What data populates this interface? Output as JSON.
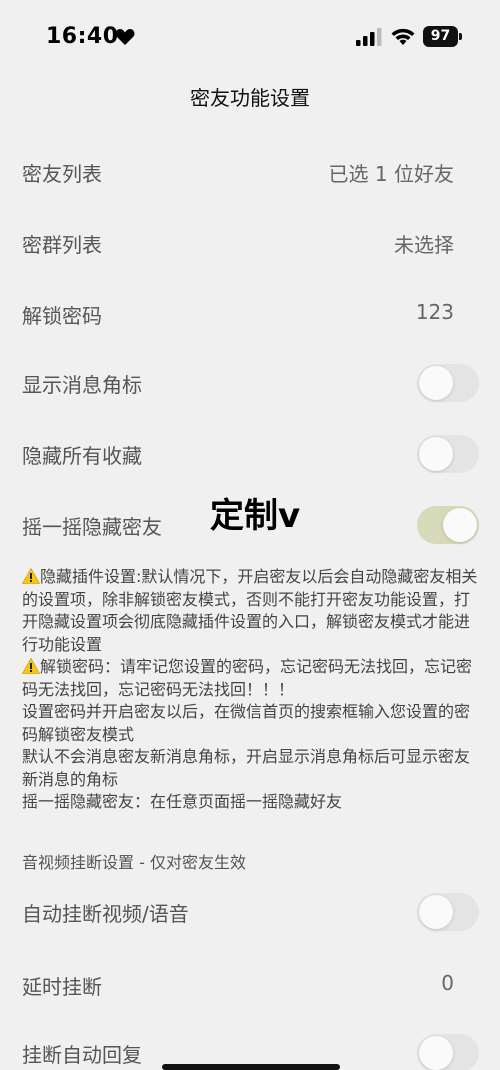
{
  "status_bar": {
    "time": "16:40",
    "battery": "97",
    "icons": [
      "heart-icon",
      "signal-icon",
      "wifi-icon",
      "battery-icon"
    ]
  },
  "header": {
    "title": "密友功能设置"
  },
  "settings": {
    "friend_list": {
      "label": "密友列表",
      "value": "已选 1 位好友"
    },
    "group_list": {
      "label": "密群列表",
      "value": "未选择"
    },
    "unlock_password": {
      "label": "解锁密码",
      "value": "123"
    },
    "show_badge": {
      "label": "显示消息角标",
      "on": false
    },
    "hide_favorites": {
      "label": "隐藏所有收藏",
      "on": false
    },
    "shake_hide": {
      "label": "摇一摇隐藏密友",
      "on": true
    }
  },
  "watermark": "定制v",
  "notes": {
    "line1": "隐藏插件设置:默认情况下，开启密友以后会自动隐藏密友相关的设置项，除非解锁密友模式，否则不能打开密友功能设置，打开隐藏设置项会彻底隐藏插件设置的入口，解锁密友模式才能进行功能设置",
    "line2": "解锁密码：请牢记您设置的密码，忘记密码无法找回，忘记密码无法找回，忘记密码无法找回！！！",
    "line3": "设置密码并开启密友以后，在微信首页的搜索框输入您设置的密码解锁密友模式",
    "line4": "默认不会消息密友新消息角标，开启显示消息角标后可显示密友新消息的角标",
    "line5": "摇一摇隐藏密友：在任意页面摇一摇隐藏好友"
  },
  "av_section": {
    "header": "音视频挂断设置 - 仅对密友生效",
    "auto_hangup": {
      "label": "自动挂断视频/语音",
      "on": false
    },
    "delay_hangup": {
      "label": "延时挂断",
      "value": "0"
    },
    "auto_reply": {
      "label": "挂断自动回复",
      "on": false
    }
  },
  "colors": {
    "background": "#f0f0f0",
    "toggle_off": "#e4e4e4",
    "toggle_on": "#d7dab8",
    "warning": "#f5c518"
  }
}
